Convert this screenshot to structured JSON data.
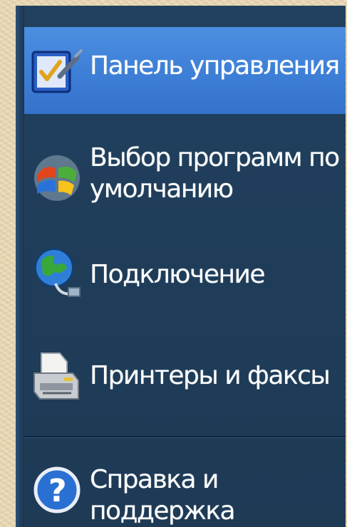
{
  "menu": {
    "items": [
      {
        "label": [
          "Панель управления"
        ],
        "icon": "control-panel-icon",
        "selected": true
      },
      {
        "label": [
          "Выбор программ по",
          "умолчанию"
        ],
        "icon": "windows-logo-icon",
        "selected": false
      },
      {
        "label": [
          "Подключение"
        ],
        "icon": "network-globe-icon",
        "selected": false
      },
      {
        "label": [
          "Принтеры и факсы"
        ],
        "icon": "printer-icon",
        "selected": false
      },
      {
        "label": [
          "Справка и",
          "поддержка"
        ],
        "icon": "help-icon",
        "selected": false
      }
    ]
  },
  "colors": {
    "menu_bg": "#21415f",
    "selection": "#3d7ed6",
    "text": "#ffffff",
    "page_bg": "#e9d8b4"
  }
}
